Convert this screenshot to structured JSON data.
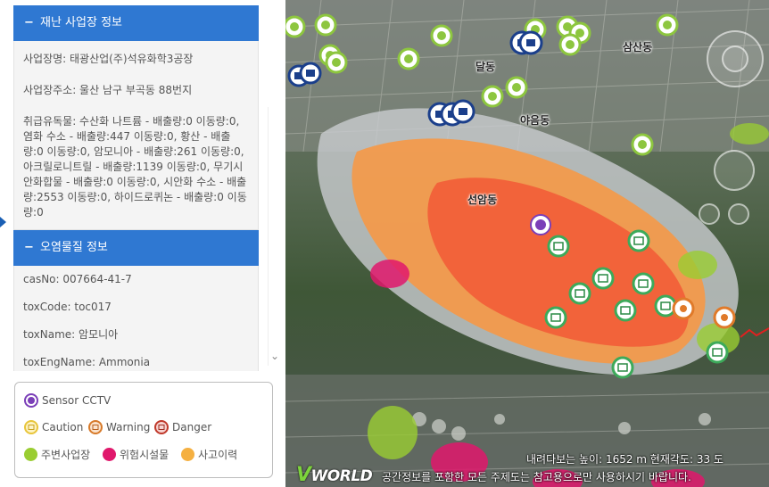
{
  "site_info": {
    "header": "재난 사업장 정보",
    "name": "사업장명: 태광산업(주)석유화학3공장",
    "address": "사업장주소: 울산 남구 부곡동 88번지",
    "materials": "취급유독물: 수산화 나트륨 - 배출량:0 이동량:0, 염화 수소 - 배출량:447 이동량:0, 황산 - 배출량:0 이동량:0, 암모니아 - 배출량:261 이동량:0, 아크릴로니트릴 - 배출량:1139 이동량:0, 무기시안화합물 - 배출량:0 이동량:0, 시안화 수소 - 배출량:2553 이동량:0, 하이드로퀴논 - 배출량:0 이동량:0"
  },
  "pollutant_info": {
    "header": "오염물질 정보",
    "cas_no": "casNo: 007664-41-7",
    "tox_code": "toxCode: toc017",
    "tox_name": "toxName: 암모니아",
    "tox_eng_name": "toxEngName: Ammonia"
  },
  "legend": {
    "sensor_cctv": "Sensor CCTV",
    "caution": "Caution",
    "warning": "Warning",
    "danger": "Danger",
    "nearby_site": "주변사업장",
    "hazard_facility": "위험시설물",
    "accident_history": "사고이력",
    "colors": {
      "sensor": "#7b3fb8",
      "caution": "#e8c53a",
      "warning": "#d77a2a",
      "danger": "#c0392b",
      "nearby_site": "#9acd32",
      "hazard_facility": "#e0186c",
      "accident_history": "#f5b041"
    }
  },
  "map": {
    "labels": {
      "samsan": "삼산동",
      "dal": "달동",
      "yaeum": "야음동",
      "seonam": "선암동"
    },
    "status": "내려다보는 높이: 1652 m   현재각도: 33 도",
    "notice": "공간정보를 포함한 모든 주제도는 참고용으로만 사용하시기 바랍니다.",
    "logo": "WORLD",
    "logo_v": "V",
    "zone_colors": {
      "outer": "#c9ccd0",
      "middle": "#f29a4c",
      "inner": "#f2633a"
    }
  },
  "icons": {
    "panel_edge": "triangle-right-icon",
    "scroll_down": "chevron-down-icon",
    "section_toggle": "minus-icon"
  }
}
